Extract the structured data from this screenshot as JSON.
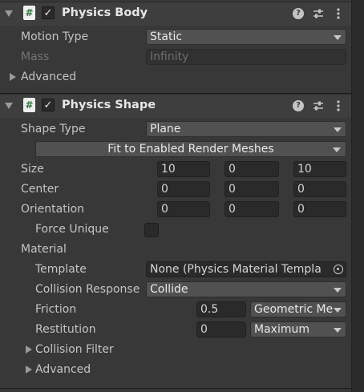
{
  "colors": {
    "background": "#383838",
    "header": "#3e3e3e",
    "field": "#2a2a2a",
    "dropdown": "#515151",
    "script_icon": "#267a3c"
  },
  "physics_body": {
    "title": "Physics Body",
    "script_icon": "#",
    "enabled_mark": "✓",
    "help_glyph": "?",
    "motion_type": {
      "label": "Motion Type",
      "value": "Static"
    },
    "mass": {
      "label": "Mass",
      "value": "Infinity"
    },
    "advanced_label": "Advanced"
  },
  "physics_shape": {
    "title": "Physics Shape",
    "script_icon": "#",
    "enabled_mark": "✓",
    "help_glyph": "?",
    "shape_type": {
      "label": "Shape Type",
      "value": "Plane"
    },
    "fit_button": "Fit to Enabled Render Meshes",
    "size": {
      "label": "Size",
      "values": [
        "10",
        "0",
        "10"
      ]
    },
    "center": {
      "label": "Center",
      "values": [
        "0",
        "0",
        "0"
      ]
    },
    "orientation": {
      "label": "Orientation",
      "values": [
        "0",
        "0",
        "0"
      ]
    },
    "force_unique": {
      "label": "Force Unique",
      "checked": false
    },
    "material": {
      "label": "Material",
      "template": {
        "label": "Template",
        "value": "None (Physics Material Templa"
      },
      "collision_response": {
        "label": "Collision Response",
        "value": "Collide"
      },
      "friction": {
        "label": "Friction",
        "value": "0.5",
        "mode": "Geometric Me"
      },
      "restitution": {
        "label": "Restitution",
        "value": "0",
        "mode": "Maximum"
      }
    },
    "collision_filter_label": "Collision Filter",
    "advanced_label": "Advanced"
  }
}
